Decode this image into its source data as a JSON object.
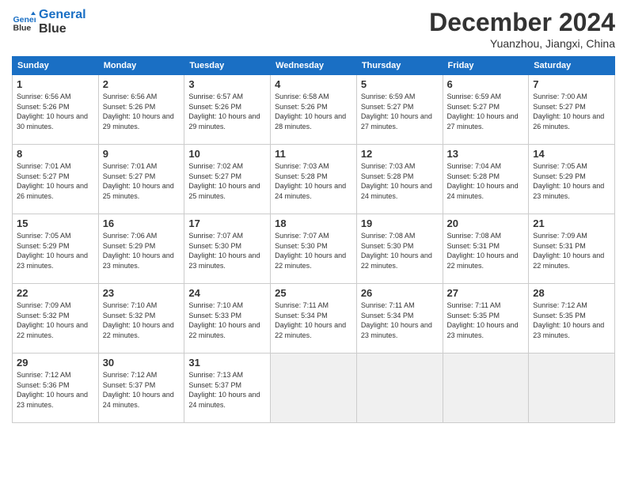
{
  "header": {
    "logo_line1": "General",
    "logo_line2": "Blue",
    "month_title": "December 2024",
    "location": "Yuanzhou, Jiangxi, China"
  },
  "weekdays": [
    "Sunday",
    "Monday",
    "Tuesday",
    "Wednesday",
    "Thursday",
    "Friday",
    "Saturday"
  ],
  "weeks": [
    [
      {
        "day": "1",
        "sunrise": "6:56 AM",
        "sunset": "5:26 PM",
        "daylight": "10 hours and 30 minutes."
      },
      {
        "day": "2",
        "sunrise": "6:56 AM",
        "sunset": "5:26 PM",
        "daylight": "10 hours and 29 minutes."
      },
      {
        "day": "3",
        "sunrise": "6:57 AM",
        "sunset": "5:26 PM",
        "daylight": "10 hours and 29 minutes."
      },
      {
        "day": "4",
        "sunrise": "6:58 AM",
        "sunset": "5:26 PM",
        "daylight": "10 hours and 28 minutes."
      },
      {
        "day": "5",
        "sunrise": "6:59 AM",
        "sunset": "5:27 PM",
        "daylight": "10 hours and 27 minutes."
      },
      {
        "day": "6",
        "sunrise": "6:59 AM",
        "sunset": "5:27 PM",
        "daylight": "10 hours and 27 minutes."
      },
      {
        "day": "7",
        "sunrise": "7:00 AM",
        "sunset": "5:27 PM",
        "daylight": "10 hours and 26 minutes."
      }
    ],
    [
      {
        "day": "8",
        "sunrise": "7:01 AM",
        "sunset": "5:27 PM",
        "daylight": "10 hours and 26 minutes."
      },
      {
        "day": "9",
        "sunrise": "7:01 AM",
        "sunset": "5:27 PM",
        "daylight": "10 hours and 25 minutes."
      },
      {
        "day": "10",
        "sunrise": "7:02 AM",
        "sunset": "5:27 PM",
        "daylight": "10 hours and 25 minutes."
      },
      {
        "day": "11",
        "sunrise": "7:03 AM",
        "sunset": "5:28 PM",
        "daylight": "10 hours and 24 minutes."
      },
      {
        "day": "12",
        "sunrise": "7:03 AM",
        "sunset": "5:28 PM",
        "daylight": "10 hours and 24 minutes."
      },
      {
        "day": "13",
        "sunrise": "7:04 AM",
        "sunset": "5:28 PM",
        "daylight": "10 hours and 24 minutes."
      },
      {
        "day": "14",
        "sunrise": "7:05 AM",
        "sunset": "5:29 PM",
        "daylight": "10 hours and 23 minutes."
      }
    ],
    [
      {
        "day": "15",
        "sunrise": "7:05 AM",
        "sunset": "5:29 PM",
        "daylight": "10 hours and 23 minutes."
      },
      {
        "day": "16",
        "sunrise": "7:06 AM",
        "sunset": "5:29 PM",
        "daylight": "10 hours and 23 minutes."
      },
      {
        "day": "17",
        "sunrise": "7:07 AM",
        "sunset": "5:30 PM",
        "daylight": "10 hours and 23 minutes."
      },
      {
        "day": "18",
        "sunrise": "7:07 AM",
        "sunset": "5:30 PM",
        "daylight": "10 hours and 22 minutes."
      },
      {
        "day": "19",
        "sunrise": "7:08 AM",
        "sunset": "5:30 PM",
        "daylight": "10 hours and 22 minutes."
      },
      {
        "day": "20",
        "sunrise": "7:08 AM",
        "sunset": "5:31 PM",
        "daylight": "10 hours and 22 minutes."
      },
      {
        "day": "21",
        "sunrise": "7:09 AM",
        "sunset": "5:31 PM",
        "daylight": "10 hours and 22 minutes."
      }
    ],
    [
      {
        "day": "22",
        "sunrise": "7:09 AM",
        "sunset": "5:32 PM",
        "daylight": "10 hours and 22 minutes."
      },
      {
        "day": "23",
        "sunrise": "7:10 AM",
        "sunset": "5:32 PM",
        "daylight": "10 hours and 22 minutes."
      },
      {
        "day": "24",
        "sunrise": "7:10 AM",
        "sunset": "5:33 PM",
        "daylight": "10 hours and 22 minutes."
      },
      {
        "day": "25",
        "sunrise": "7:11 AM",
        "sunset": "5:34 PM",
        "daylight": "10 hours and 22 minutes."
      },
      {
        "day": "26",
        "sunrise": "7:11 AM",
        "sunset": "5:34 PM",
        "daylight": "10 hours and 23 minutes."
      },
      {
        "day": "27",
        "sunrise": "7:11 AM",
        "sunset": "5:35 PM",
        "daylight": "10 hours and 23 minutes."
      },
      {
        "day": "28",
        "sunrise": "7:12 AM",
        "sunset": "5:35 PM",
        "daylight": "10 hours and 23 minutes."
      }
    ],
    [
      {
        "day": "29",
        "sunrise": "7:12 AM",
        "sunset": "5:36 PM",
        "daylight": "10 hours and 23 minutes."
      },
      {
        "day": "30",
        "sunrise": "7:12 AM",
        "sunset": "5:37 PM",
        "daylight": "10 hours and 24 minutes."
      },
      {
        "day": "31",
        "sunrise": "7:13 AM",
        "sunset": "5:37 PM",
        "daylight": "10 hours and 24 minutes."
      },
      null,
      null,
      null,
      null
    ]
  ]
}
